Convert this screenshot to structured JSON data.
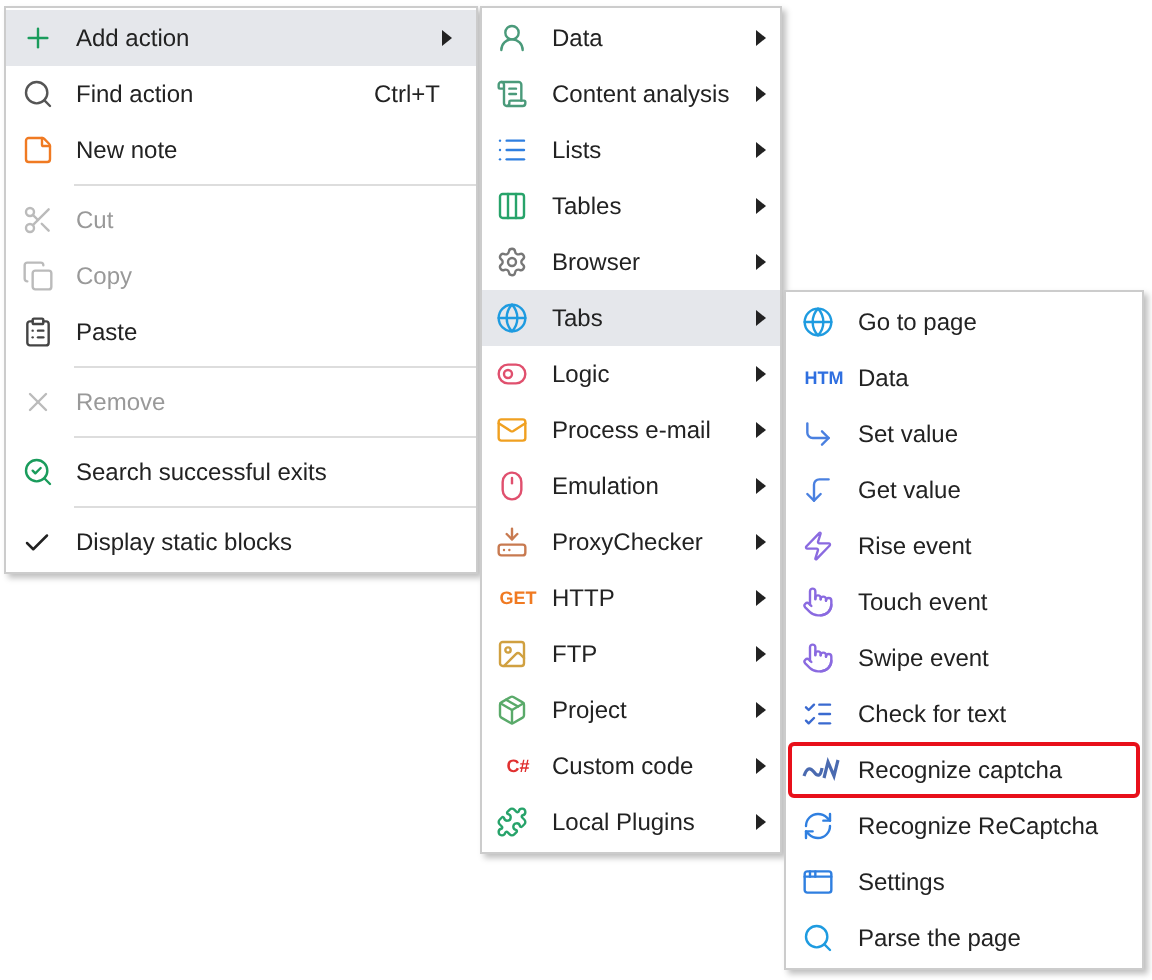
{
  "main_menu": [
    {
      "kind": "item",
      "label": "Add action",
      "submenu": true,
      "disabled": false,
      "selected": true,
      "checked": false
    },
    {
      "kind": "item",
      "label": "Find action",
      "shortcut": "Ctrl+T",
      "submenu": false,
      "disabled": false,
      "selected": false,
      "checked": false
    },
    {
      "kind": "item",
      "label": "New note",
      "submenu": false,
      "disabled": false,
      "selected": false,
      "checked": false
    },
    {
      "kind": "separator"
    },
    {
      "kind": "item",
      "label": "Cut",
      "submenu": false,
      "disabled": true,
      "selected": false,
      "checked": false
    },
    {
      "kind": "item",
      "label": "Copy",
      "submenu": false,
      "disabled": true,
      "selected": false,
      "checked": false
    },
    {
      "kind": "item",
      "label": "Paste",
      "submenu": false,
      "disabled": false,
      "selected": false,
      "checked": false
    },
    {
      "kind": "separator"
    },
    {
      "kind": "item",
      "label": "Remove",
      "submenu": false,
      "disabled": true,
      "selected": false,
      "checked": false
    },
    {
      "kind": "separator"
    },
    {
      "kind": "item",
      "label": "Search successful exits",
      "submenu": false,
      "disabled": false,
      "selected": false,
      "checked": false
    },
    {
      "kind": "separator"
    },
    {
      "kind": "item",
      "label": "Display static blocks",
      "submenu": false,
      "disabled": false,
      "selected": false,
      "checked": true
    }
  ],
  "action_menu": [
    {
      "label": "Data",
      "selected": false
    },
    {
      "label": "Content analysis",
      "selected": false
    },
    {
      "label": "Lists",
      "selected": false
    },
    {
      "label": "Tables",
      "selected": false
    },
    {
      "label": "Browser",
      "selected": false
    },
    {
      "label": "Tabs",
      "selected": true
    },
    {
      "label": "Logic",
      "selected": false
    },
    {
      "label": "Process e-mail",
      "selected": false
    },
    {
      "label": "Emulation",
      "selected": false
    },
    {
      "label": "ProxyChecker",
      "selected": false
    },
    {
      "label": "HTTP",
      "selected": false,
      "icon_text": "GET"
    },
    {
      "label": "FTP",
      "selected": false
    },
    {
      "label": "Project",
      "selected": false
    },
    {
      "label": "Custom code",
      "selected": false,
      "icon_text": "C#"
    },
    {
      "label": "Local Plugins",
      "selected": false
    }
  ],
  "tabs_menu": [
    {
      "label": "Go to page",
      "outlined": false
    },
    {
      "label": "Data",
      "outlined": false,
      "icon_text": "HTM"
    },
    {
      "label": "Set value",
      "outlined": false
    },
    {
      "label": "Get value",
      "outlined": false
    },
    {
      "label": "Rise event",
      "outlined": false
    },
    {
      "label": "Touch event",
      "outlined": false
    },
    {
      "label": "Swipe event",
      "outlined": false
    },
    {
      "label": "Check for text",
      "outlined": false
    },
    {
      "label": "Recognize captcha",
      "outlined": true
    },
    {
      "label": "Recognize ReCaptcha",
      "outlined": false
    },
    {
      "label": "Settings",
      "outlined": false
    },
    {
      "label": "Parse the page",
      "outlined": false
    }
  ]
}
